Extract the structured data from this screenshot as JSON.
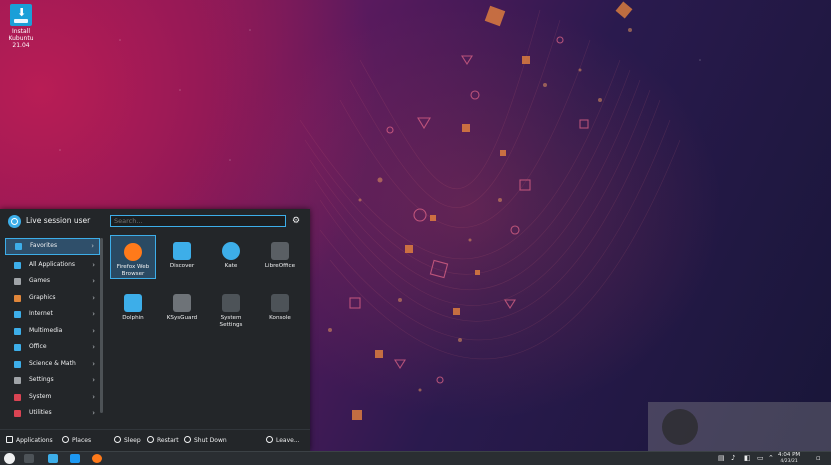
{
  "desktop": {
    "icon_label_line1": "Install Kubuntu",
    "icon_label_line2": "21.04"
  },
  "menu": {
    "user_name": "Live session user",
    "search_placeholder": "Search...",
    "categories": [
      {
        "label": "Favorites",
        "icon": "star-icon",
        "color": "#3daee9"
      },
      {
        "label": "All Applications",
        "icon": "grid-icon",
        "color": "#3daee9"
      },
      {
        "label": "Games",
        "icon": "gamepad-icon",
        "color": "#a0a4a8"
      },
      {
        "label": "Graphics",
        "icon": "graphics-icon",
        "color": "#e0863a"
      },
      {
        "label": "Internet",
        "icon": "globe-icon",
        "color": "#3daee9"
      },
      {
        "label": "Multimedia",
        "icon": "multimedia-icon",
        "color": "#3daee9"
      },
      {
        "label": "Office",
        "icon": "office-icon",
        "color": "#3daee9"
      },
      {
        "label": "Science & Math",
        "icon": "science-icon",
        "color": "#3daee9"
      },
      {
        "label": "Settings",
        "icon": "settings-icon",
        "color": "#a0a4a8"
      },
      {
        "label": "System",
        "icon": "system-icon",
        "color": "#da4453"
      },
      {
        "label": "Utilities",
        "icon": "utilities-icon",
        "color": "#da4453"
      }
    ],
    "apps": [
      {
        "line1": "Firefox Web",
        "line2": "Browser",
        "icon": "firefox-icon",
        "color": "#ff7a1a"
      },
      {
        "line1": "Discover",
        "line2": "",
        "icon": "discover-icon",
        "color": "#3daee9"
      },
      {
        "line1": "Kate",
        "line2": "",
        "icon": "kate-icon",
        "color": "#3daee9"
      },
      {
        "line1": "LibreOffice",
        "line2": "",
        "icon": "libreoffice-icon",
        "color": "#5a5f64"
      },
      {
        "line1": "Dolphin",
        "line2": "",
        "icon": "dolphin-icon",
        "color": "#3daee9"
      },
      {
        "line1": "KSysGuard",
        "line2": "",
        "icon": "ksysguard-icon",
        "color": "#6e7378"
      },
      {
        "line1": "System",
        "line2": "Settings",
        "icon": "system-settings-icon",
        "color": "#4d5358"
      },
      {
        "line1": "Konsole",
        "line2": "",
        "icon": "konsole-icon",
        "color": "#4d5358"
      }
    ],
    "footer": {
      "applications": "Applications",
      "places": "Places",
      "sleep": "Sleep",
      "restart": "Restart",
      "shutdown": "Shut Down",
      "leave": "Leave..."
    }
  },
  "panel": {
    "time": "4:04 PM",
    "date": "4/23/21"
  }
}
